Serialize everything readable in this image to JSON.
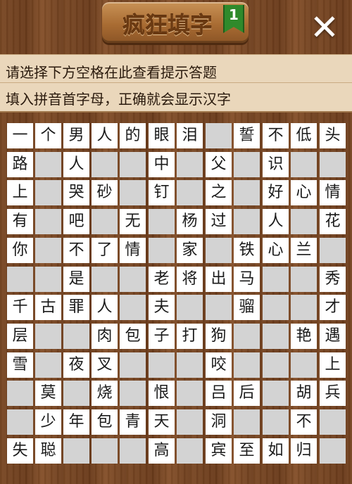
{
  "header": {
    "title": "疯狂填字",
    "level_badge": "1",
    "close_icon": "close-icon"
  },
  "hint": {
    "line1": "请选择下方空格在此查看提示答题",
    "line2": "填入拼音首字母，正确就会显示汉字"
  },
  "grid": {
    "rows": [
      [
        "一",
        "个",
        "男",
        "人",
        "的",
        "眼",
        "泪",
        "#",
        "誓",
        "不",
        "低",
        "头"
      ],
      [
        "路",
        "#",
        "人",
        "#",
        "#",
        "中",
        "#",
        "父",
        "#",
        "识",
        "#",
        "#"
      ],
      [
        "上",
        "#",
        "哭",
        "砂",
        "#",
        "钉",
        "#",
        "之",
        "#",
        "好",
        "心",
        "情"
      ],
      [
        "有",
        "#",
        "吧",
        "#",
        "无",
        "#",
        "杨",
        "过",
        "#",
        "人",
        "#",
        "花"
      ],
      [
        "你",
        "#",
        "不",
        "了",
        "情",
        "#",
        "家",
        "#",
        "铁",
        "心",
        "兰",
        "#"
      ],
      [
        "#",
        "#",
        "是",
        "#",
        "#",
        "老",
        "将",
        "出",
        "马",
        "#",
        "#",
        "秀"
      ],
      [
        "千",
        "古",
        "罪",
        "人",
        "#",
        "夫",
        "#",
        "#",
        "骝",
        "#",
        "#",
        "才"
      ],
      [
        "层",
        "#",
        "#",
        "肉",
        "包",
        "子",
        "打",
        "狗",
        "#",
        "#",
        "艳",
        "遇"
      ],
      [
        "雪",
        "#",
        "夜",
        "叉",
        "#",
        "#",
        "#",
        "咬",
        "#",
        "#",
        "#",
        "上"
      ],
      [
        "#",
        "莫",
        "#",
        "烧",
        "#",
        "恨",
        "#",
        "吕",
        "后",
        "#",
        "胡",
        "兵"
      ],
      [
        "#",
        "少",
        "年",
        "包",
        "青",
        "天",
        "#",
        "洞",
        "#",
        "#",
        "不",
        "#"
      ],
      [
        "失",
        "聪",
        "#",
        "#",
        "#",
        "高",
        "#",
        "宾",
        "至",
        "如",
        "归",
        "#"
      ]
    ]
  },
  "colors": {
    "wood": "#6b3f1f",
    "hint_bg": "#ead7bb",
    "blank_cell": "#d3d3d3",
    "filled_cell": "#ffffff",
    "badge": "#2f8a2b"
  }
}
